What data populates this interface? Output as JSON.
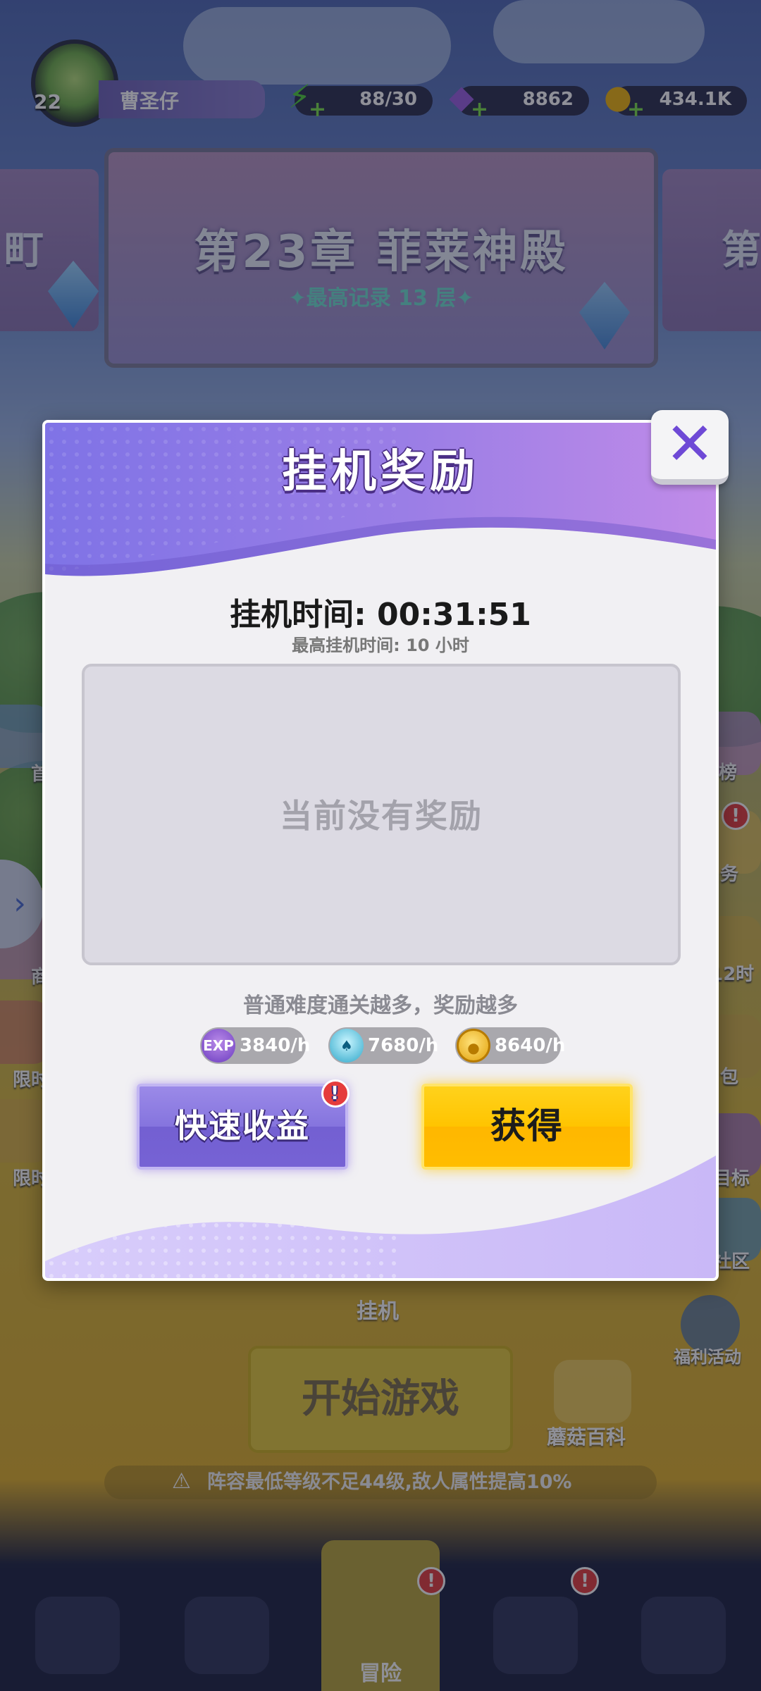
{
  "player": {
    "level": "22",
    "name": "曹圣仔"
  },
  "resources": {
    "energy": {
      "icon": "lightning-icon",
      "value": "88/30"
    },
    "gems": {
      "icon": "gem-icon",
      "value": "8862"
    },
    "coins": {
      "icon": "coin-icon",
      "value": "434.1K"
    }
  },
  "chapter": {
    "title": "第23章 菲莱神殿",
    "record": "✦最高记录 13 层✦",
    "left_partial": "町",
    "right_partial": "第"
  },
  "side_menu": {
    "right": [
      {
        "label": "榜"
      },
      {
        "label": "务"
      },
      {
        "label": "12时"
      },
      {
        "label": "包"
      },
      {
        "label": "目标"
      },
      {
        "label": "社区"
      },
      {
        "label": "福利活动"
      }
    ],
    "left": [
      {
        "label": "首"
      },
      {
        "label": "商"
      },
      {
        "label": "限时"
      },
      {
        "label": "限时"
      }
    ]
  },
  "main": {
    "idle_label": "挂机",
    "start_button": "开始游戏",
    "wiki_label": "蘑菇百科",
    "warning": "阵容最低等级不足44级,敌人属性提高10%"
  },
  "bottom_nav": {
    "active_label": "冒险"
  },
  "modal": {
    "title": "挂机奖励",
    "idle_time_label": "挂机时间: 00:31:51",
    "max_time": "最高挂机时间: 10 小时",
    "empty_text": "当前没有奖励",
    "hint": "普通难度通关越多，奖励越多",
    "rates": [
      {
        "icon": "exp-icon",
        "icon_text": "EXP",
        "value": "3840/h"
      },
      {
        "icon": "mushroom-icon",
        "icon_text": "",
        "value": "7680/h"
      },
      {
        "icon": "coin-icon",
        "icon_text": "",
        "value": "8640/h"
      }
    ],
    "quick_button": "快速收益",
    "get_button": "获得",
    "badge": "!"
  },
  "colors": {
    "accent_purple": "#8574de",
    "accent_yellow": "#ffc400",
    "badge_red": "#e53c3c"
  }
}
